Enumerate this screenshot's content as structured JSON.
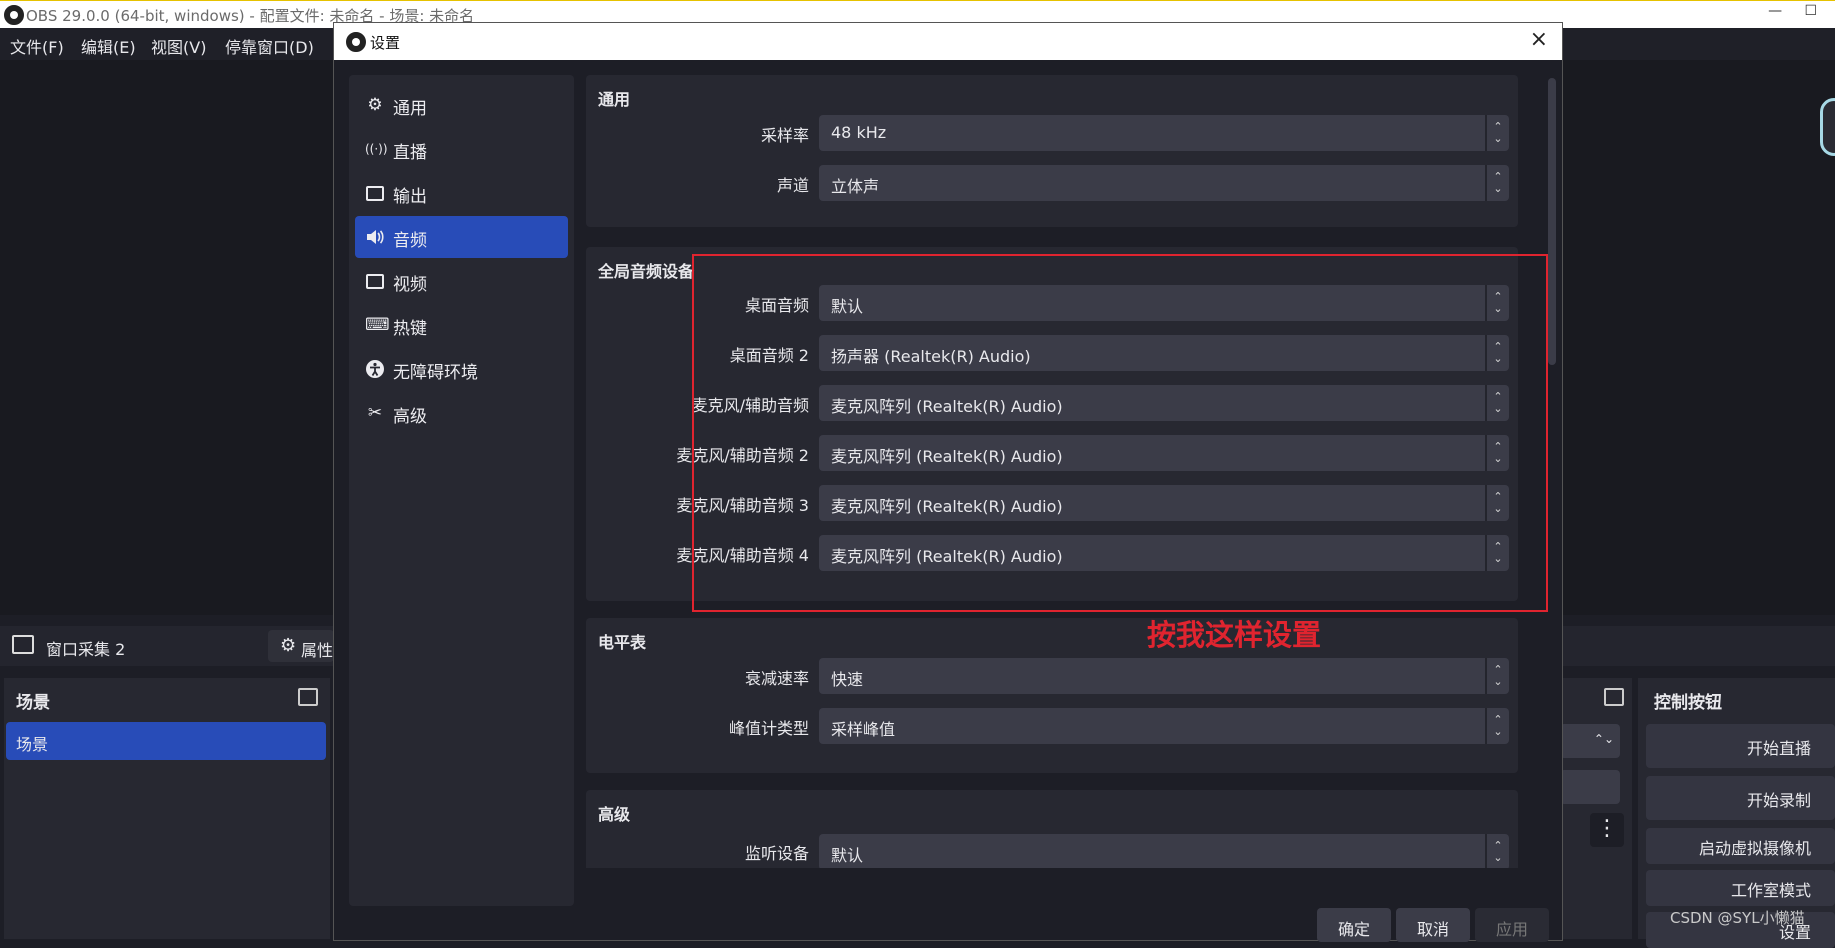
{
  "main": {
    "title": "OBS 29.0.0 (64-bit, windows) - 配置文件: 未命名 - 场景: 未命名",
    "window_controls": [
      "—",
      "☐"
    ],
    "menu": [
      "文件(F)",
      "编辑(E)",
      "视图(V)",
      "停靠窗口(D)"
    ],
    "source_name": "窗口采集 2",
    "properties_label": "属性",
    "scene_dock_title": "场景",
    "scene_item": "场景",
    "controls_title": "控制按钮",
    "controls": [
      "开始直播",
      "开始录制",
      "启动虚拟摄像机",
      "工作室模式",
      "设置"
    ]
  },
  "settings": {
    "title": "设置",
    "close_icon": "×",
    "sidebar": [
      {
        "label": "通用",
        "icon": "gear-icon",
        "glyph": "⚙"
      },
      {
        "label": "直播",
        "icon": "antenna-icon",
        "glyph": "((·))"
      },
      {
        "label": "输出",
        "icon": "output-icon",
        "glyph": "▭"
      },
      {
        "label": "音频",
        "icon": "speaker-icon",
        "glyph": "🔊"
      },
      {
        "label": "视频",
        "icon": "monitor-icon",
        "glyph": "▭"
      },
      {
        "label": "热键",
        "icon": "keyboard-icon",
        "glyph": "⌨"
      },
      {
        "label": "无障碍环境",
        "icon": "accessibility-icon",
        "glyph": "♿"
      },
      {
        "label": "高级",
        "icon": "tools-icon",
        "glyph": "✂"
      }
    ],
    "active_tab": "音频",
    "groups": {
      "general": {
        "title": "通用",
        "rows": [
          {
            "label": "采样率",
            "value": "48 kHz"
          },
          {
            "label": "声道",
            "value": "立体声"
          }
        ]
      },
      "global_devices": {
        "title": "全局音频设备",
        "rows": [
          {
            "label": "桌面音频",
            "value": "默认"
          },
          {
            "label": "桌面音频 2",
            "value": "扬声器 (Realtek(R) Audio)"
          },
          {
            "label": "麦克风/辅助音频",
            "value": "麦克风阵列 (Realtek(R) Audio)"
          },
          {
            "label": "麦克风/辅助音频 2",
            "value": "麦克风阵列 (Realtek(R) Audio)"
          },
          {
            "label": "麦克风/辅助音频 3",
            "value": "麦克风阵列 (Realtek(R) Audio)"
          },
          {
            "label": "麦克风/辅助音频 4",
            "value": "麦克风阵列 (Realtek(R) Audio)"
          }
        ]
      },
      "meters": {
        "title": "电平表",
        "rows": [
          {
            "label": "衰减速率",
            "value": "快速"
          },
          {
            "label": "峰值计类型",
            "value": "采样峰值"
          }
        ]
      },
      "advanced": {
        "title": "高级",
        "rows": [
          {
            "label": "监听设备",
            "value": "默认"
          }
        ]
      }
    },
    "buttons": {
      "ok": "确定",
      "cancel": "取消",
      "apply": "应用"
    }
  },
  "annotation": {
    "note": "按我这样设置",
    "color": "#e0242f"
  },
  "watermark": "CSDN @SYL小懒猫",
  "colors": {
    "accent": "#284cb8",
    "background": "#1d1e26",
    "panel": "#272831",
    "combo": "#3b3c48"
  }
}
